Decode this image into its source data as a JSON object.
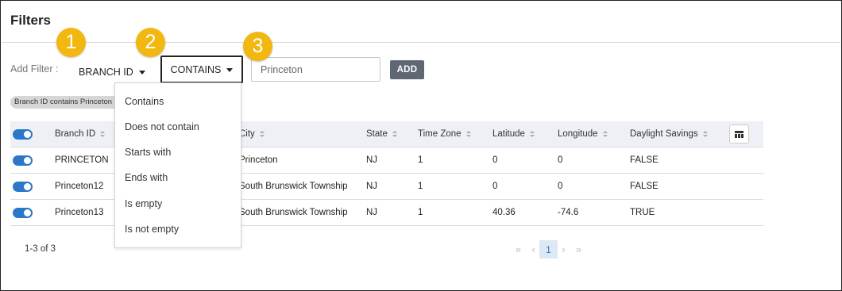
{
  "title": "Filters",
  "filter_bar": {
    "add_label": "Add Filter :",
    "field_dropdown": "BRANCH ID",
    "operator_dropdown": "CONTAINS",
    "value_input": "Princeton",
    "add_button": "ADD"
  },
  "callouts": [
    "1",
    "2",
    "3"
  ],
  "active_filter_chip": "Branch ID contains Princeton",
  "operator_menu": {
    "items": [
      "Contains",
      "Does not contain",
      "Starts with",
      "Ends with",
      "Is empty",
      "Is not empty"
    ]
  },
  "table": {
    "columns": [
      "Branch ID",
      "City",
      "State",
      "Time Zone",
      "Latitude",
      "Longitude",
      "Daylight Savings"
    ],
    "rows": [
      {
        "enabled": true,
        "branch_id": "PRINCETON",
        "city": "Princeton",
        "state": "NJ",
        "time_zone": "1",
        "latitude": "0",
        "longitude": "0",
        "daylight_savings": "FALSE"
      },
      {
        "enabled": true,
        "branch_id": "Princeton12",
        "city": "South Brunswick Township",
        "state": "NJ",
        "time_zone": "1",
        "latitude": "0",
        "longitude": "0",
        "daylight_savings": "FALSE"
      },
      {
        "enabled": true,
        "branch_id": "Princeton13",
        "city": "South Brunswick Township",
        "state": "NJ",
        "time_zone": "1",
        "latitude": "40.36",
        "longitude": "-74.6",
        "daylight_savings": "TRUE"
      }
    ]
  },
  "pagination": {
    "summary": "1-3 of 3",
    "current_page": "1",
    "first": "«",
    "prev": "‹",
    "next": "›",
    "last": "»"
  },
  "colors": {
    "toggle_on": "#2b77c8",
    "callout": "#f2b80f",
    "add_button": "#5f6773",
    "header_bg": "#eef0f6"
  }
}
